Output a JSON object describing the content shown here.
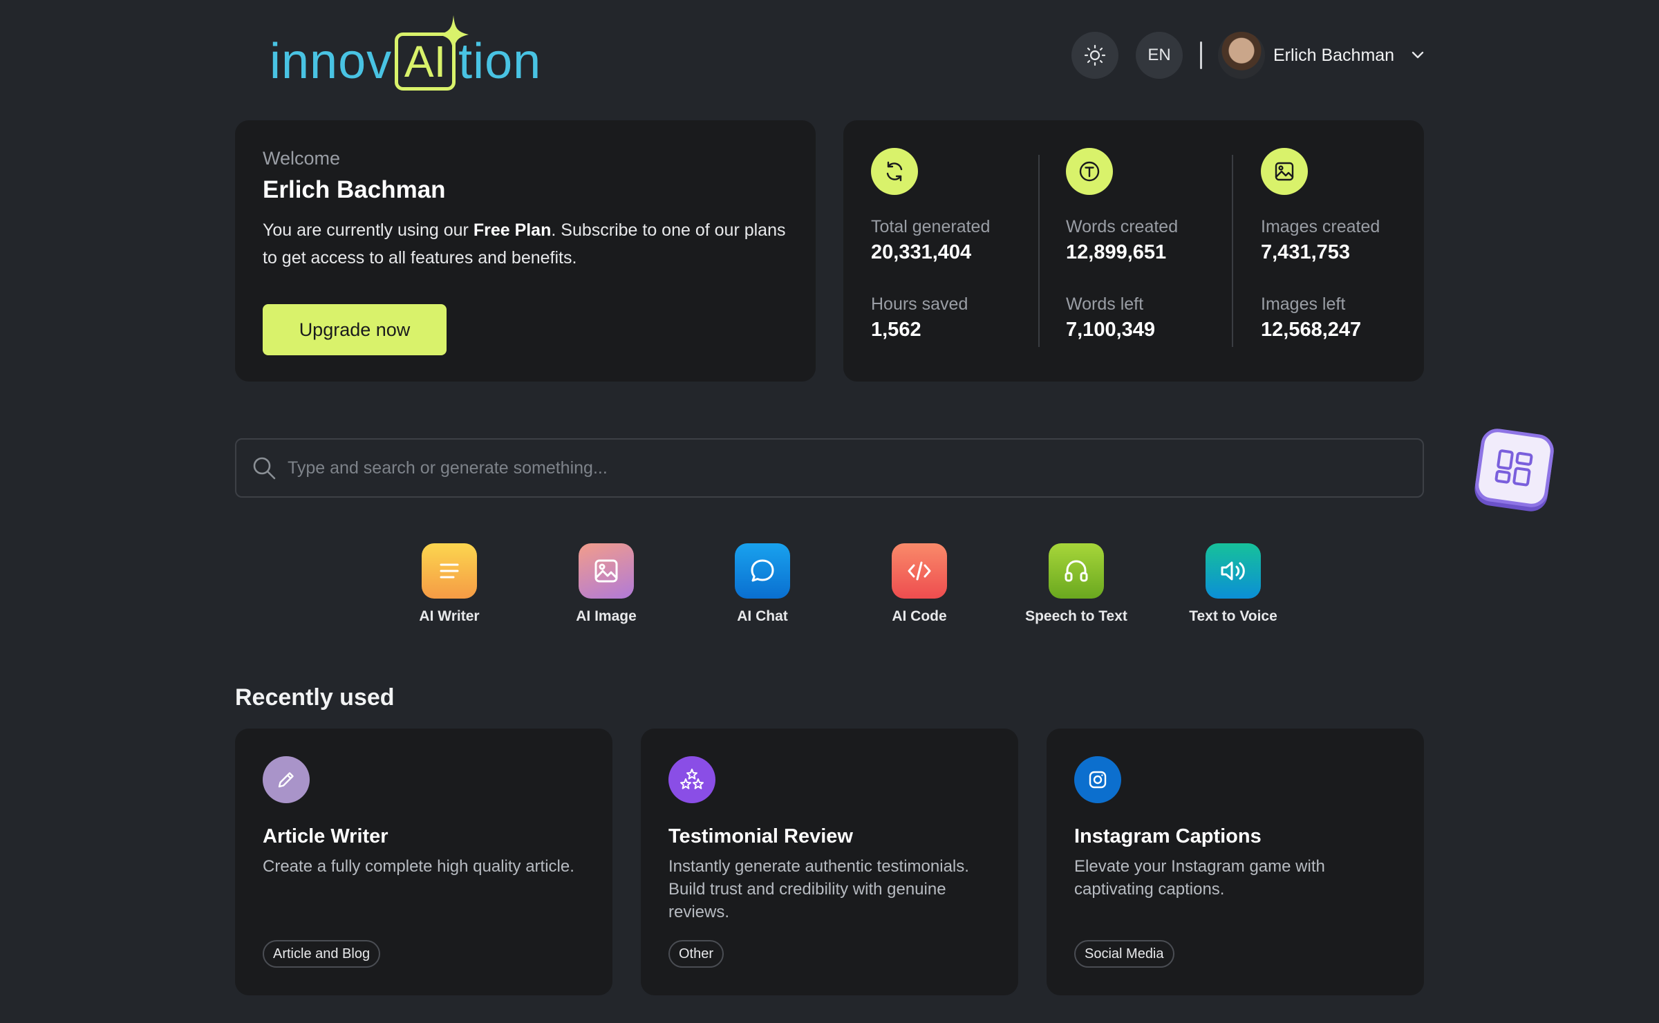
{
  "brand": {
    "logo_left": "innov",
    "logo_box": "AI",
    "logo_right": "tion",
    "colors": {
      "primary": "#49c3e3",
      "accent": "#d9f26b",
      "background": "#23262b",
      "card": "#1a1b1d"
    }
  },
  "header": {
    "theme_toggle_icon": "sun-icon",
    "language": "EN",
    "user_name": "Erlich Bachman",
    "user_menu_icon": "chevron-down-icon"
  },
  "welcome": {
    "greeting": "Welcome",
    "name": "Erlich Bachman",
    "msg_pre": "You are currently using our ",
    "plan": "Free Plan",
    "msg_post": ". Subscribe to one of our plans to get access to all features and benefits.",
    "cta": "Upgrade now"
  },
  "stats": [
    {
      "icon": "refresh-icon",
      "label": "Total generated",
      "value": "20,331,404",
      "label2": "Hours saved",
      "value2": "1,562"
    },
    {
      "icon": "text-icon",
      "label": "Words created",
      "value": "12,899,651",
      "label2": "Words left",
      "value2": "7,100,349"
    },
    {
      "icon": "image-icon",
      "label": "Images created",
      "value": "7,431,753",
      "label2": "Images left",
      "value2": "12,568,247"
    }
  ],
  "search": {
    "placeholder": "Type and search or generate something..."
  },
  "tools": [
    {
      "label": "AI Writer",
      "icon": "lines-icon"
    },
    {
      "label": "AI Image",
      "icon": "image-icon"
    },
    {
      "label": "AI Chat",
      "icon": "chat-bubble-icon"
    },
    {
      "label": "AI Code",
      "icon": "code-icon"
    },
    {
      "label": "Speech to Text",
      "icon": "headphones-icon"
    },
    {
      "label": "Text to Voice",
      "icon": "speaker-icon"
    }
  ],
  "recent": {
    "title": "Recently used",
    "items": [
      {
        "title": "Article Writer",
        "desc": "Create a fully complete high quality article.",
        "tag": "Article and Blog",
        "icon": "pencil-icon"
      },
      {
        "title": "Testimonial Review",
        "desc": "Instantly generate authentic testimonials. Build trust and credibility with genuine reviews.",
        "tag": "Other",
        "icon": "stars-icon"
      },
      {
        "title": "Instagram Captions",
        "desc": "Elevate your Instagram game with captivating captions.",
        "tag": "Social Media",
        "icon": "instagram-icon"
      }
    ]
  }
}
